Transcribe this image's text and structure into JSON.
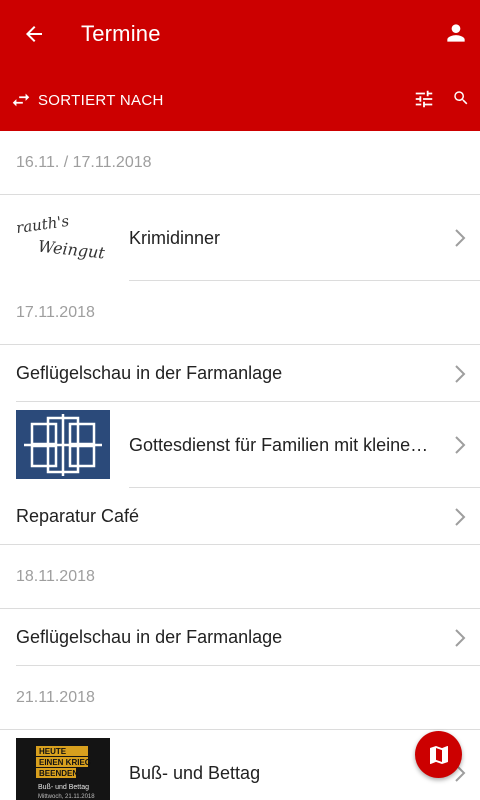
{
  "appbar": {
    "title": "Termine",
    "sort_label": "SORTIERT NACH",
    "icons": [
      "back-arrow-icon",
      "account-icon",
      "swap-icon",
      "filter-sliders-icon",
      "search-icon"
    ],
    "background": "#cc0000"
  },
  "groups": [
    {
      "date": "16.11. / 17.11.2018",
      "items": [
        {
          "title": "Krimidinner",
          "thumb": "weingut-logo"
        }
      ]
    },
    {
      "date": "17.11.2018",
      "items": [
        {
          "title": "Geflügelschau in der Farmanlage",
          "thumb": null
        },
        {
          "title": "Gottesdienst für Familien mit kleine…",
          "thumb": "blue-pattern"
        },
        {
          "title": "Reparatur Café",
          "thumb": null
        }
      ]
    },
    {
      "date": "18.11.2018",
      "items": [
        {
          "title": "Geflügelschau in der Farmanlage",
          "thumb": null
        }
      ]
    },
    {
      "date": "21.11.2018",
      "items": [
        {
          "title": "Buß- und Bettag",
          "thumb": "poster"
        }
      ]
    }
  ],
  "thumbs": {
    "weingut": {
      "line1": "rauth's",
      "line2": "Weingut"
    },
    "poster": {
      "line1": "HEUTE",
      "line2": "EINEN KRIEG",
      "line3": "BEENDEN.",
      "line4": "Buß- und Bettag",
      "line5": "Mittwoch, 21.11.2018"
    }
  },
  "fab": {
    "icon": "map-icon"
  }
}
